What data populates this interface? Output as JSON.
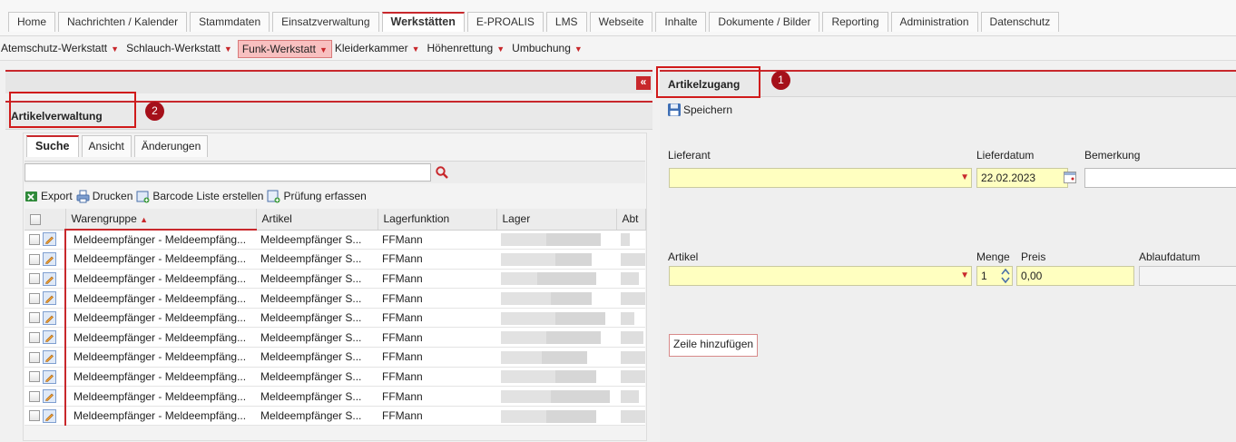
{
  "top_tabs": [
    "Home",
    "Nachrichten / Kalender",
    "Stammdaten",
    "Einsatzverwaltung",
    "Werkstätten",
    "E-PROALIS",
    "LMS",
    "Webseite",
    "Inhalte",
    "Dokumente / Bilder",
    "Reporting",
    "Administration",
    "Datenschutz"
  ],
  "active_top_tab": "Werkstätten",
  "sub_menu": [
    "Atemschutz-Werkstatt",
    "Schlauch-Werkstatt",
    "Funk-Werkstatt",
    "Kleiderkammer",
    "Höhenrettung",
    "Umbuchung"
  ],
  "active_sub_menu": "Funk-Werkstatt",
  "left_panel": {
    "collapse_symbol": "«",
    "title": "Artikelverwaltung",
    "badge": "2",
    "tabs": [
      "Suche",
      "Ansicht",
      "Änderungen"
    ],
    "active_tab": "Suche",
    "search_value": "",
    "toolbar": {
      "export": "Export",
      "print": "Drucken",
      "barcode": "Barcode Liste erstellen",
      "check": "Prüfung erfassen"
    },
    "columns": {
      "warengruppe": "Warengruppe",
      "sort_arrow": "▲",
      "artikel": "Artikel",
      "lagerfunktion": "Lagerfunktion",
      "lager": "Lager",
      "abt": "Abt"
    },
    "rows": [
      {
        "warengruppe": "Meldeempfänger - Meldeempfäng...",
        "artikel": "Meldeempfänger S...",
        "lagerfunktion": "FFMann"
      },
      {
        "warengruppe": "Meldeempfänger - Meldeempfäng...",
        "artikel": "Meldeempfänger S...",
        "lagerfunktion": "FFMann"
      },
      {
        "warengruppe": "Meldeempfänger - Meldeempfäng...",
        "artikel": "Meldeempfänger S...",
        "lagerfunktion": "FFMann"
      },
      {
        "warengruppe": "Meldeempfänger - Meldeempfäng...",
        "artikel": "Meldeempfänger S...",
        "lagerfunktion": "FFMann"
      },
      {
        "warengruppe": "Meldeempfänger - Meldeempfäng...",
        "artikel": "Meldeempfänger S...",
        "lagerfunktion": "FFMann"
      },
      {
        "warengruppe": "Meldeempfänger - Meldeempfäng...",
        "artikel": "Meldeempfänger S...",
        "lagerfunktion": "FFMann"
      },
      {
        "warengruppe": "Meldeempfänger - Meldeempfäng...",
        "artikel": "Meldeempfänger S...",
        "lagerfunktion": "FFMann"
      },
      {
        "warengruppe": "Meldeempfänger - Meldeempfäng...",
        "artikel": "Meldeempfänger S...",
        "lagerfunktion": "FFMann"
      },
      {
        "warengruppe": "Meldeempfänger - Meldeempfäng...",
        "artikel": "Meldeempfänger S...",
        "lagerfunktion": "FFMann"
      },
      {
        "warengruppe": "Meldeempfänger - Meldeempfäng...",
        "artikel": "Meldeempfänger S...",
        "lagerfunktion": "FFMann"
      }
    ]
  },
  "right_panel": {
    "title": "Artikelzugang",
    "badge": "1",
    "save_label": "Speichern",
    "labels": {
      "lieferant": "Lieferant",
      "lieferdatum": "Lieferdatum",
      "bemerkung": "Bemerkung",
      "artikel": "Artikel",
      "menge": "Menge",
      "preis": "Preis",
      "ablaufdatum": "Ablaufdatum"
    },
    "values": {
      "lieferant": "",
      "lieferdatum": "22.02.2023",
      "bemerkung": "",
      "artikel": "",
      "menge": "1",
      "preis": "0,00",
      "ablaufdatum": ""
    },
    "add_row_label": "Zeile hinzufügen"
  },
  "colors": {
    "accent": "#c8282c",
    "highlight_box": "#d01a1a",
    "badge": "#a5101a",
    "required_field": "#ffffc0"
  },
  "icons": {
    "export": "excel-export-icon",
    "print": "printer-icon",
    "barcode": "barcode-list-icon",
    "check": "check-record-icon",
    "search": "search-icon",
    "save": "floppy-disk-icon",
    "calendar": "calendar-icon",
    "edit": "edit-pencil-icon"
  }
}
